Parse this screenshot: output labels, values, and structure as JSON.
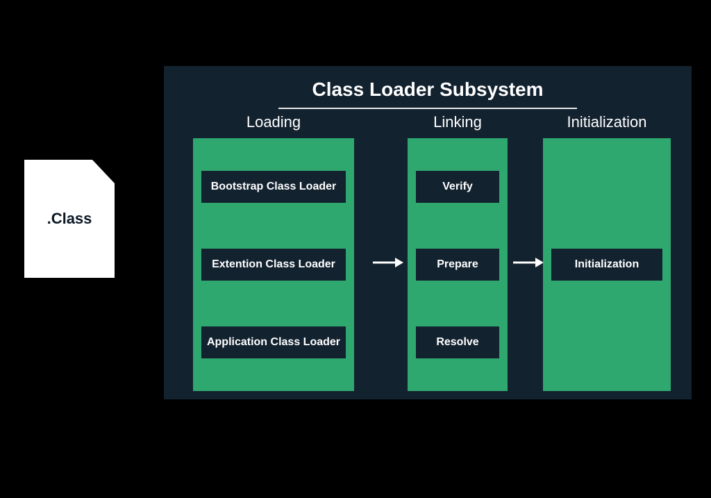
{
  "file": {
    "label": ".Class"
  },
  "subsystem": {
    "title": "Class Loader Subsystem",
    "phases": {
      "loading": {
        "label": "Loading",
        "items": [
          "Bootstrap Class Loader",
          "Extention Class Loader",
          "Application Class Loader"
        ]
      },
      "linking": {
        "label": "Linking",
        "items": [
          "Verify",
          "Prepare",
          "Resolve"
        ]
      },
      "initialization": {
        "label": "Initialization",
        "items": [
          "Initialization"
        ]
      }
    }
  }
}
